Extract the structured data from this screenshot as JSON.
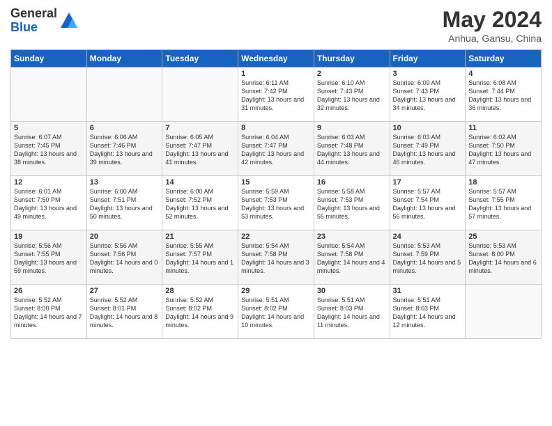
{
  "logo": {
    "general": "General",
    "blue": "Blue"
  },
  "title": "May 2024",
  "subtitle": "Anhua, Gansu, China",
  "days_of_week": [
    "Sunday",
    "Monday",
    "Tuesday",
    "Wednesday",
    "Thursday",
    "Friday",
    "Saturday"
  ],
  "weeks": [
    [
      {
        "day": "",
        "info": ""
      },
      {
        "day": "",
        "info": ""
      },
      {
        "day": "",
        "info": ""
      },
      {
        "day": "1",
        "info": "Sunrise: 6:11 AM\nSunset: 7:42 PM\nDaylight: 13 hours and 31 minutes."
      },
      {
        "day": "2",
        "info": "Sunrise: 6:10 AM\nSunset: 7:43 PM\nDaylight: 13 hours and 32 minutes."
      },
      {
        "day": "3",
        "info": "Sunrise: 6:09 AM\nSunset: 7:43 PM\nDaylight: 13 hours and 34 minutes."
      },
      {
        "day": "4",
        "info": "Sunrise: 6:08 AM\nSunset: 7:44 PM\nDaylight: 13 hours and 36 minutes."
      }
    ],
    [
      {
        "day": "5",
        "info": "Sunrise: 6:07 AM\nSunset: 7:45 PM\nDaylight: 13 hours and 38 minutes."
      },
      {
        "day": "6",
        "info": "Sunrise: 6:06 AM\nSunset: 7:46 PM\nDaylight: 13 hours and 39 minutes."
      },
      {
        "day": "7",
        "info": "Sunrise: 6:05 AM\nSunset: 7:47 PM\nDaylight: 13 hours and 41 minutes."
      },
      {
        "day": "8",
        "info": "Sunrise: 6:04 AM\nSunset: 7:47 PM\nDaylight: 13 hours and 42 minutes."
      },
      {
        "day": "9",
        "info": "Sunrise: 6:03 AM\nSunset: 7:48 PM\nDaylight: 13 hours and 44 minutes."
      },
      {
        "day": "10",
        "info": "Sunrise: 6:03 AM\nSunset: 7:49 PM\nDaylight: 13 hours and 46 minutes."
      },
      {
        "day": "11",
        "info": "Sunrise: 6:02 AM\nSunset: 7:50 PM\nDaylight: 13 hours and 47 minutes."
      }
    ],
    [
      {
        "day": "12",
        "info": "Sunrise: 6:01 AM\nSunset: 7:50 PM\nDaylight: 13 hours and 49 minutes."
      },
      {
        "day": "13",
        "info": "Sunrise: 6:00 AM\nSunset: 7:51 PM\nDaylight: 13 hours and 50 minutes."
      },
      {
        "day": "14",
        "info": "Sunrise: 6:00 AM\nSunset: 7:52 PM\nDaylight: 13 hours and 52 minutes."
      },
      {
        "day": "15",
        "info": "Sunrise: 5:59 AM\nSunset: 7:53 PM\nDaylight: 13 hours and 53 minutes."
      },
      {
        "day": "16",
        "info": "Sunrise: 5:58 AM\nSunset: 7:53 PM\nDaylight: 13 hours and 55 minutes."
      },
      {
        "day": "17",
        "info": "Sunrise: 5:57 AM\nSunset: 7:54 PM\nDaylight: 13 hours and 56 minutes."
      },
      {
        "day": "18",
        "info": "Sunrise: 5:57 AM\nSunset: 7:55 PM\nDaylight: 13 hours and 57 minutes."
      }
    ],
    [
      {
        "day": "19",
        "info": "Sunrise: 5:56 AM\nSunset: 7:55 PM\nDaylight: 13 hours and 59 minutes."
      },
      {
        "day": "20",
        "info": "Sunrise: 5:56 AM\nSunset: 7:56 PM\nDaylight: 14 hours and 0 minutes."
      },
      {
        "day": "21",
        "info": "Sunrise: 5:55 AM\nSunset: 7:57 PM\nDaylight: 14 hours and 1 minutes."
      },
      {
        "day": "22",
        "info": "Sunrise: 5:54 AM\nSunset: 7:58 PM\nDaylight: 14 hours and 3 minutes."
      },
      {
        "day": "23",
        "info": "Sunrise: 5:54 AM\nSunset: 7:58 PM\nDaylight: 14 hours and 4 minutes."
      },
      {
        "day": "24",
        "info": "Sunrise: 5:53 AM\nSunset: 7:59 PM\nDaylight: 14 hours and 5 minutes."
      },
      {
        "day": "25",
        "info": "Sunrise: 5:53 AM\nSunset: 8:00 PM\nDaylight: 14 hours and 6 minutes."
      }
    ],
    [
      {
        "day": "26",
        "info": "Sunrise: 5:52 AM\nSunset: 8:00 PM\nDaylight: 14 hours and 7 minutes."
      },
      {
        "day": "27",
        "info": "Sunrise: 5:52 AM\nSunset: 8:01 PM\nDaylight: 14 hours and 8 minutes."
      },
      {
        "day": "28",
        "info": "Sunrise: 5:52 AM\nSunset: 8:02 PM\nDaylight: 14 hours and 9 minutes."
      },
      {
        "day": "29",
        "info": "Sunrise: 5:51 AM\nSunset: 8:02 PM\nDaylight: 14 hours and 10 minutes."
      },
      {
        "day": "30",
        "info": "Sunrise: 5:51 AM\nSunset: 8:03 PM\nDaylight: 14 hours and 11 minutes."
      },
      {
        "day": "31",
        "info": "Sunrise: 5:51 AM\nSunset: 8:03 PM\nDaylight: 14 hours and 12 minutes."
      },
      {
        "day": "",
        "info": ""
      }
    ]
  ]
}
